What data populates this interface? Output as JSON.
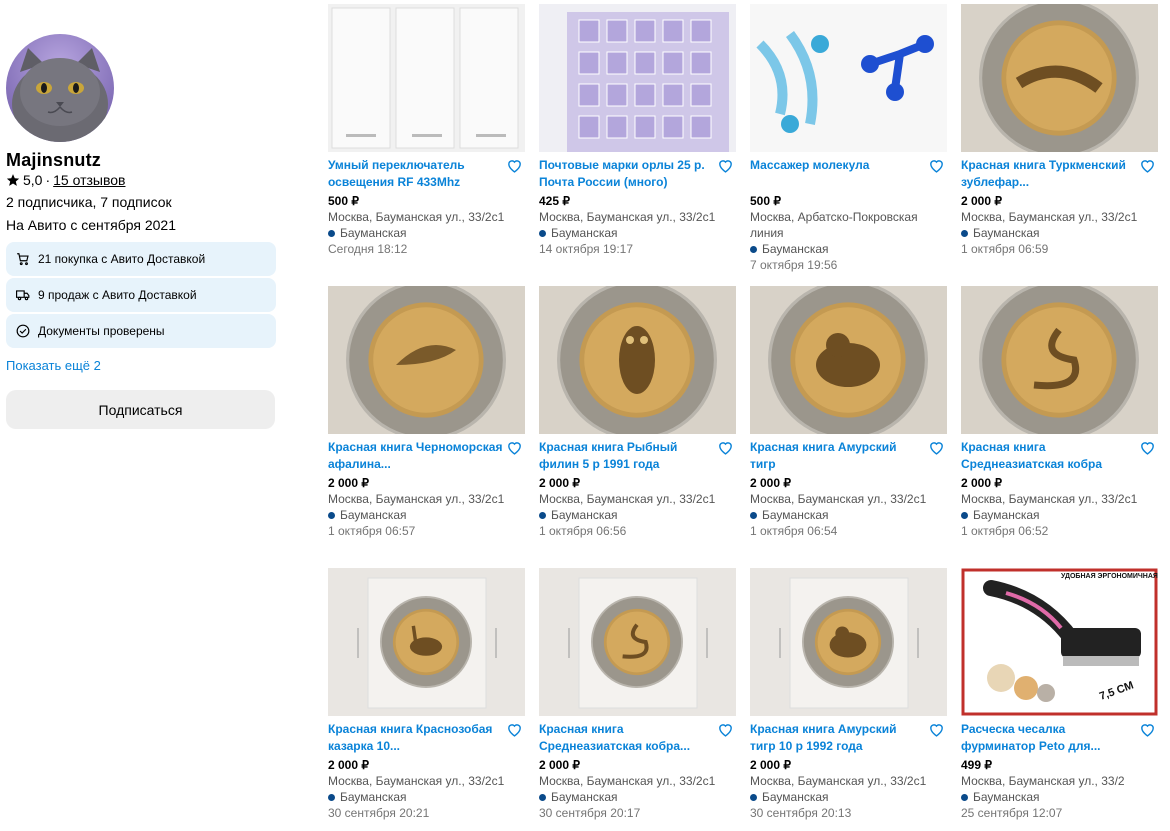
{
  "profile": {
    "avatar_alt": "avatar",
    "name": "Majinsnutz",
    "rating": "5,0",
    "separator": "·",
    "reviews": "15 отзывов",
    "subscriptions": "2 подписчика, 7 подписок",
    "since": "На Авито с сентября 2021",
    "badges": [
      {
        "icon": "cart-icon",
        "label": "21 покупка с Авито Доставкой"
      },
      {
        "icon": "truck-icon",
        "label": "9 продаж с Авито Доставкой"
      },
      {
        "icon": "check-circle-icon",
        "label": "Документы проверены"
      }
    ],
    "show_more": "Показать ещё 2",
    "subscribe": "Подписаться"
  },
  "colors": {
    "link": "#0a83d8",
    "badge_bg": "#e7f3fb",
    "metro": "#0a4a8a"
  },
  "listings": [
    {
      "title": "Умный переключатель освещения RF 433Mhz",
      "price": "500 ₽",
      "address": "Москва, Бауманская ул., 33/2с1",
      "metro": "Бауманская",
      "date": "Сегодня 18:12",
      "image": "switch"
    },
    {
      "title": "Почтовые марки орлы 25 р. Почта России (много)",
      "price": "425 ₽",
      "address": "Москва, Бауманская ул., 33/2с1",
      "metro": "Бауманская",
      "date": "14 октября 19:17",
      "image": "stamps"
    },
    {
      "title": "Массажер молекула",
      "price": "500 ₽",
      "address": "Москва, Арбатско-Покровская линия",
      "metro": "Бауманская",
      "date": "7 октября 19:56",
      "image": "massager"
    },
    {
      "title": "Красная книга Туркменский зублефар...",
      "price": "2 000 ₽",
      "address": "Москва, Бауманская ул., 33/2с1",
      "metro": "Бауманская",
      "date": "1 октября 06:59",
      "image": "coin-lizard"
    },
    {
      "title": "Красная книга Черноморская афалина...",
      "price": "2 000 ₽",
      "address": "Москва, Бауманская ул., 33/2с1",
      "metro": "Бауманская",
      "date": "1 октября 06:57",
      "image": "coin-dolphin"
    },
    {
      "title": "Красная книга Рыбный филин 5 р 1991 года",
      "price": "2 000 ₽",
      "address": "Москва, Бауманская ул., 33/2с1",
      "metro": "Бауманская",
      "date": "1 октября 06:56",
      "image": "coin-owl"
    },
    {
      "title": "Красная книга Амурский тигр",
      "price": "2 000 ₽",
      "address": "Москва, Бауманская ул., 33/2с1",
      "metro": "Бауманская",
      "date": "1 октября 06:54",
      "image": "coin-tiger"
    },
    {
      "title": "Красная книга Среднеазиатская кобра",
      "price": "2 000 ₽",
      "address": "Москва, Бауманская ул., 33/2с1",
      "metro": "Бауманская",
      "date": "1 октября 06:52",
      "image": "coin-cobra"
    },
    {
      "title": "Красная книга Краснозобая казарка 10...",
      "price": "2 000 ₽",
      "address": "Москва, Бауманская ул., 33/2с1",
      "metro": "Бауманская",
      "date": "30 сентября 20:21",
      "image": "coin-goose-small"
    },
    {
      "title": "Красная книга Среднеазиатская кобра...",
      "price": "2 000 ₽",
      "address": "Москва, Бауманская ул., 33/2с1",
      "metro": "Бауманская",
      "date": "30 сентября 20:17",
      "image": "coin-cobra-small"
    },
    {
      "title": "Красная книга Амурский тигр 10 р 1992 года",
      "price": "2 000 ₽",
      "address": "Москва, Бауманская ул., 33/2с1",
      "metro": "Бауманская",
      "date": "30 сентября 20:13",
      "image": "coin-tiger-small"
    },
    {
      "title": "Расческа чесалка фурминатор Peto для...",
      "price": "499 ₽",
      "address": "Москва, Бауманская ул., 33/2",
      "metro": "Бауманская",
      "date": "25 сентября 12:07",
      "image": "brush"
    }
  ],
  "brush_image_text": {
    "caption": "УДОБНАЯ ЭРГОНОМИЧНАЯ РУЧКА",
    "size": "7,5 СМ"
  }
}
